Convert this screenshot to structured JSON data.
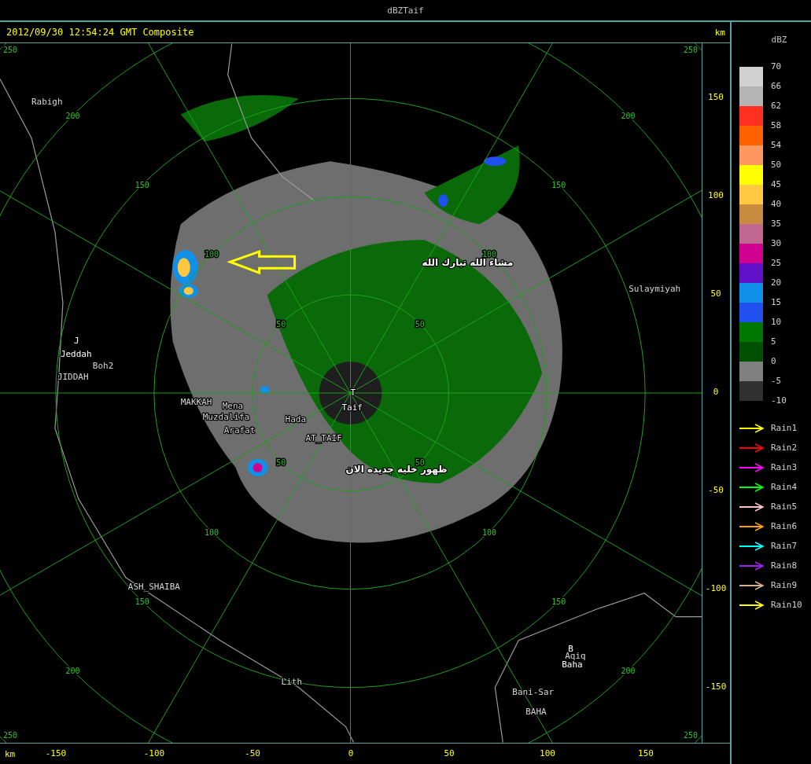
{
  "window": {
    "title": "dBZTaif"
  },
  "header": {
    "timestamp": "2012/09/30 12:54:24 GMT Composite",
    "unit": "km"
  },
  "range_rings": [
    {
      "labels": [
        "50",
        "50",
        "50",
        "50"
      ]
    },
    {
      "labels": [
        "100",
        "100",
        "100",
        "100"
      ]
    },
    {
      "labels": [
        "150",
        "150",
        "150",
        "150"
      ]
    },
    {
      "labels": [
        "200",
        "200",
        "200",
        "200"
      ]
    },
    {
      "labels": [
        "250",
        "250",
        "250",
        "250"
      ]
    }
  ],
  "map_labels": [
    {
      "text": "Rabigh",
      "kind": "place"
    },
    {
      "text": "J",
      "kind": "station"
    },
    {
      "text": "Jeddah",
      "kind": "station"
    },
    {
      "text": "Boh2",
      "kind": "place"
    },
    {
      "text": "JIDDAH",
      "kind": "place"
    },
    {
      "text": "MAKKAH",
      "kind": "place"
    },
    {
      "text": "Mena",
      "kind": "place"
    },
    {
      "text": "Muzdalifa",
      "kind": "place"
    },
    {
      "text": "Arafat",
      "kind": "place"
    },
    {
      "text": "Hada",
      "kind": "place"
    },
    {
      "text": "AT_TAIF",
      "kind": "place"
    },
    {
      "text": "T",
      "kind": "station"
    },
    {
      "text": "Taif",
      "kind": "station"
    },
    {
      "text": "Sulaymiyah",
      "kind": "place"
    },
    {
      "text": "ASH_SHAIBA",
      "kind": "place"
    },
    {
      "text": "Lith",
      "kind": "place"
    },
    {
      "text": "B",
      "kind": "station"
    },
    {
      "text": "Aqiq",
      "kind": "place"
    },
    {
      "text": "Baha",
      "kind": "station"
    },
    {
      "text": "Bani-Sar",
      "kind": "place"
    },
    {
      "text": "BAHA",
      "kind": "place"
    },
    {
      "text": "مشاء الله تبارك الله",
      "kind": "note"
    },
    {
      "text": "ظهور خليه جديده الان",
      "kind": "note"
    }
  ],
  "y_axis": {
    "ticks": [
      "150",
      "100",
      "50",
      "0",
      "-50",
      "-100",
      "-150"
    ]
  },
  "x_axis": {
    "unit": "km",
    "ticks": [
      "-150",
      "-100",
      "-50",
      "0",
      "50",
      "100",
      "150"
    ]
  },
  "legend": {
    "title": "dBZ",
    "bands": [
      {
        "color": "#d0d0d0"
      },
      {
        "color": "#b4b4b4"
      },
      {
        "color": "#ff3020"
      },
      {
        "color": "#ff6000"
      },
      {
        "color": "#ff9860"
      },
      {
        "color": "#ffff00"
      },
      {
        "color": "#ffc840"
      },
      {
        "color": "#c88c40"
      },
      {
        "color": "#c06890"
      },
      {
        "color": "#d00090"
      },
      {
        "color": "#6010c8"
      },
      {
        "color": "#1090e8"
      },
      {
        "color": "#2050f0"
      },
      {
        "color": "#007800"
      },
      {
        "color": "#005000"
      },
      {
        "color": "#808080"
      },
      {
        "color": "#303030"
      }
    ],
    "ticks": [
      "70",
      "66",
      "62",
      "58",
      "54",
      "50",
      "45",
      "40",
      "35",
      "30",
      "25",
      "20",
      "15",
      "10",
      "5",
      "0",
      "-5",
      "-10"
    ]
  },
  "tracks": [
    {
      "label": "Rain1",
      "color": "#ffff00"
    },
    {
      "label": "Rain2",
      "color": "#ff0000"
    },
    {
      "label": "Rain3",
      "color": "#ff00ff"
    },
    {
      "label": "Rain4",
      "color": "#00ff00"
    },
    {
      "label": "Rain5",
      "color": "#ffc0cb"
    },
    {
      "label": "Rain6",
      "color": "#ffa000"
    },
    {
      "label": "Rain7",
      "color": "#00ffff"
    },
    {
      "label": "Rain8",
      "color": "#a020f0"
    },
    {
      "label": "Rain9",
      "color": "#d2b48c"
    },
    {
      "label": "Rain10",
      "color": "#ffff00"
    }
  ]
}
